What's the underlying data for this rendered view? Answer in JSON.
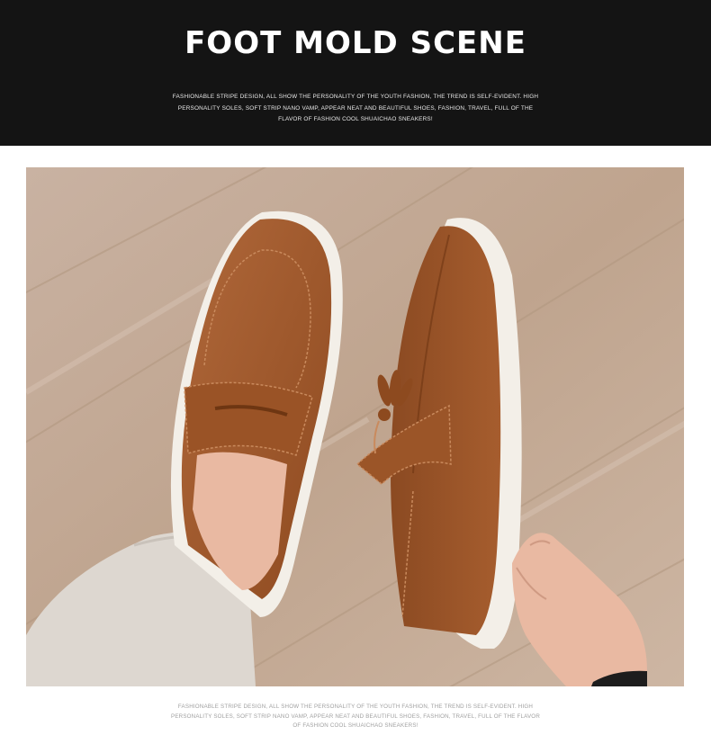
{
  "banner": {
    "title": "FOOT MOLD SCENE",
    "description": "FASHIONABLE STRIPE DESIGN, ALL SHOW THE PERSONALITY OF THE YOUTH FASHION, THE TREND IS SELF-EVIDENT. HIGH PERSONALITY SOLES, SOFT STRIP NANO VAMP, APPEAR NEAT AND BEAUTIFUL SHOES, FASHION, TRAVEL, FULL OF THE FLAVOR OF FASHION COOL SHUAICHAO SNEAKERS!"
  },
  "photo": {
    "subject": "Brown suede loafers on a wooden floor",
    "colors": {
      "suede": "#a2592a",
      "sole": "#f3efe8",
      "floor": "#c7ad99",
      "trouser": "#ddd7d0",
      "skin": "#e9b9a2"
    }
  },
  "footer": {
    "description": "FASHIONABLE STRIPE DESIGN, ALL SHOW THE PERSONALITY OF THE YOUTH FASHION, THE TREND IS SELF-EVIDENT. HIGH PERSONALITY SOLES, SOFT STRIP NANO VAMP, APPEAR NEAT AND BEAUTIFUL SHOES, FASHION, TRAVEL, FULL OF THE FLAVOR OF FASHION COOL SHUAICHAO SNEAKERS!"
  }
}
